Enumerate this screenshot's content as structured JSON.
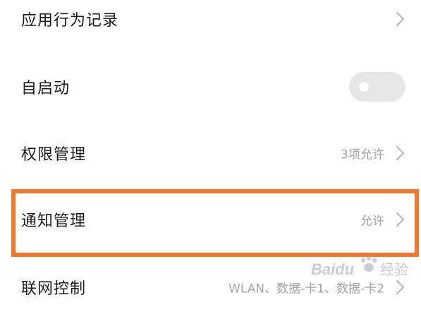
{
  "rows": [
    {
      "label": "应用行为记录",
      "value": "",
      "control": "chevron"
    },
    {
      "label": "自启动",
      "value": "",
      "control": "toggle",
      "toggle_on": false
    },
    {
      "label": "权限管理",
      "value": "3项允许",
      "control": "chevron"
    },
    {
      "label": "通知管理",
      "value": "允许",
      "control": "chevron",
      "highlighted": true
    },
    {
      "label": "联网控制",
      "value": "WLAN、数据-卡1、数据-卡2",
      "control": "chevron"
    }
  ],
  "highlight_color": "#f3762a",
  "watermark": {
    "brand": "Baidu",
    "text": "经验"
  },
  "icons": {
    "chevron": "chevron-right-icon",
    "toggle": "toggle-switch",
    "watermark": "baidu-paw-icon"
  }
}
